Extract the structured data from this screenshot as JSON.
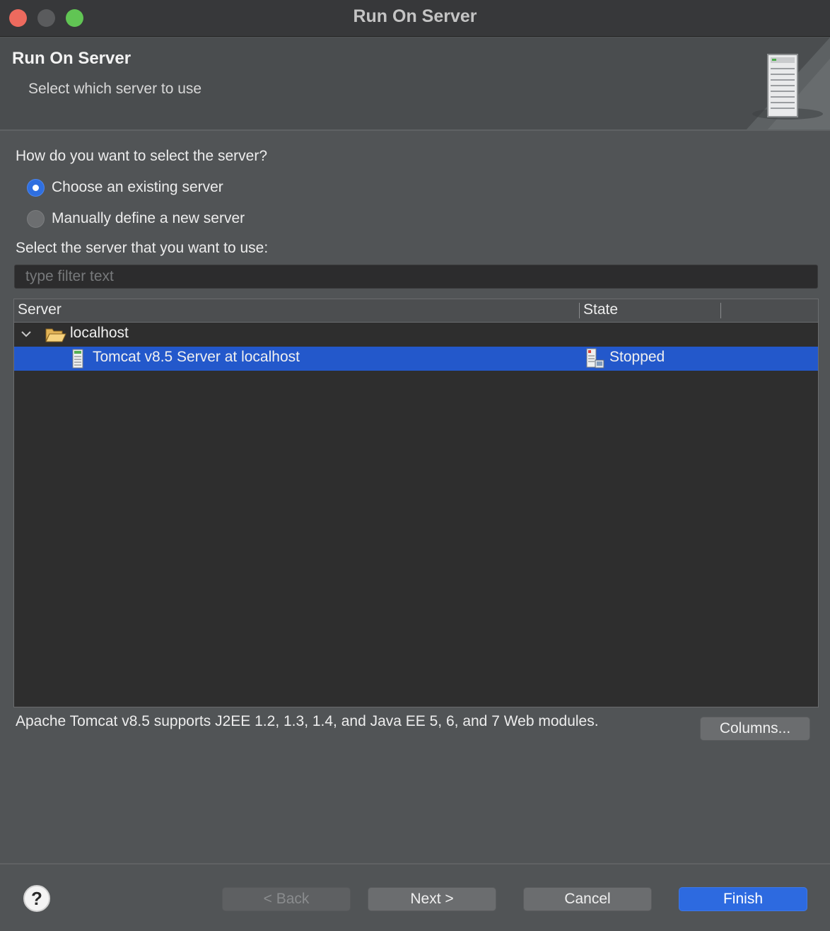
{
  "window": {
    "title": "Run On Server"
  },
  "banner": {
    "title": "Run On Server",
    "subtitle": "Select which server to use",
    "icon": "server-tower-icon"
  },
  "selection": {
    "question": "How do you want to select the server?",
    "options": [
      {
        "label": "Choose an existing server",
        "selected": true
      },
      {
        "label": "Manually define a new server",
        "selected": false
      }
    ]
  },
  "server_list": {
    "label": "Select the server that you want to use:",
    "filter_placeholder": "type filter text",
    "filter_value": "",
    "columns": [
      "Server",
      "State"
    ],
    "rows": [
      {
        "type": "group",
        "expanded": true,
        "icon": "folder-open-icon",
        "name": "localhost",
        "state": ""
      },
      {
        "type": "server",
        "icon": "tomcat-server-icon",
        "name": "Tomcat v8.5 Server at localhost",
        "state_icon": "server-stopped-icon",
        "state": "Stopped",
        "selected": true
      }
    ]
  },
  "description": "Apache Tomcat v8.5 supports J2EE 1.2, 1.3, 1.4, and Java EE 5, 6, and 7 Web modules.",
  "buttons": {
    "columns": "Columns...",
    "back": "< Back",
    "next": "Next >",
    "cancel": "Cancel",
    "finish": "Finish",
    "help": "?"
  },
  "colors": {
    "selection_blue": "#2358cb",
    "primary_button": "#2d6ae0",
    "radio_on": "#2f6fe0"
  }
}
